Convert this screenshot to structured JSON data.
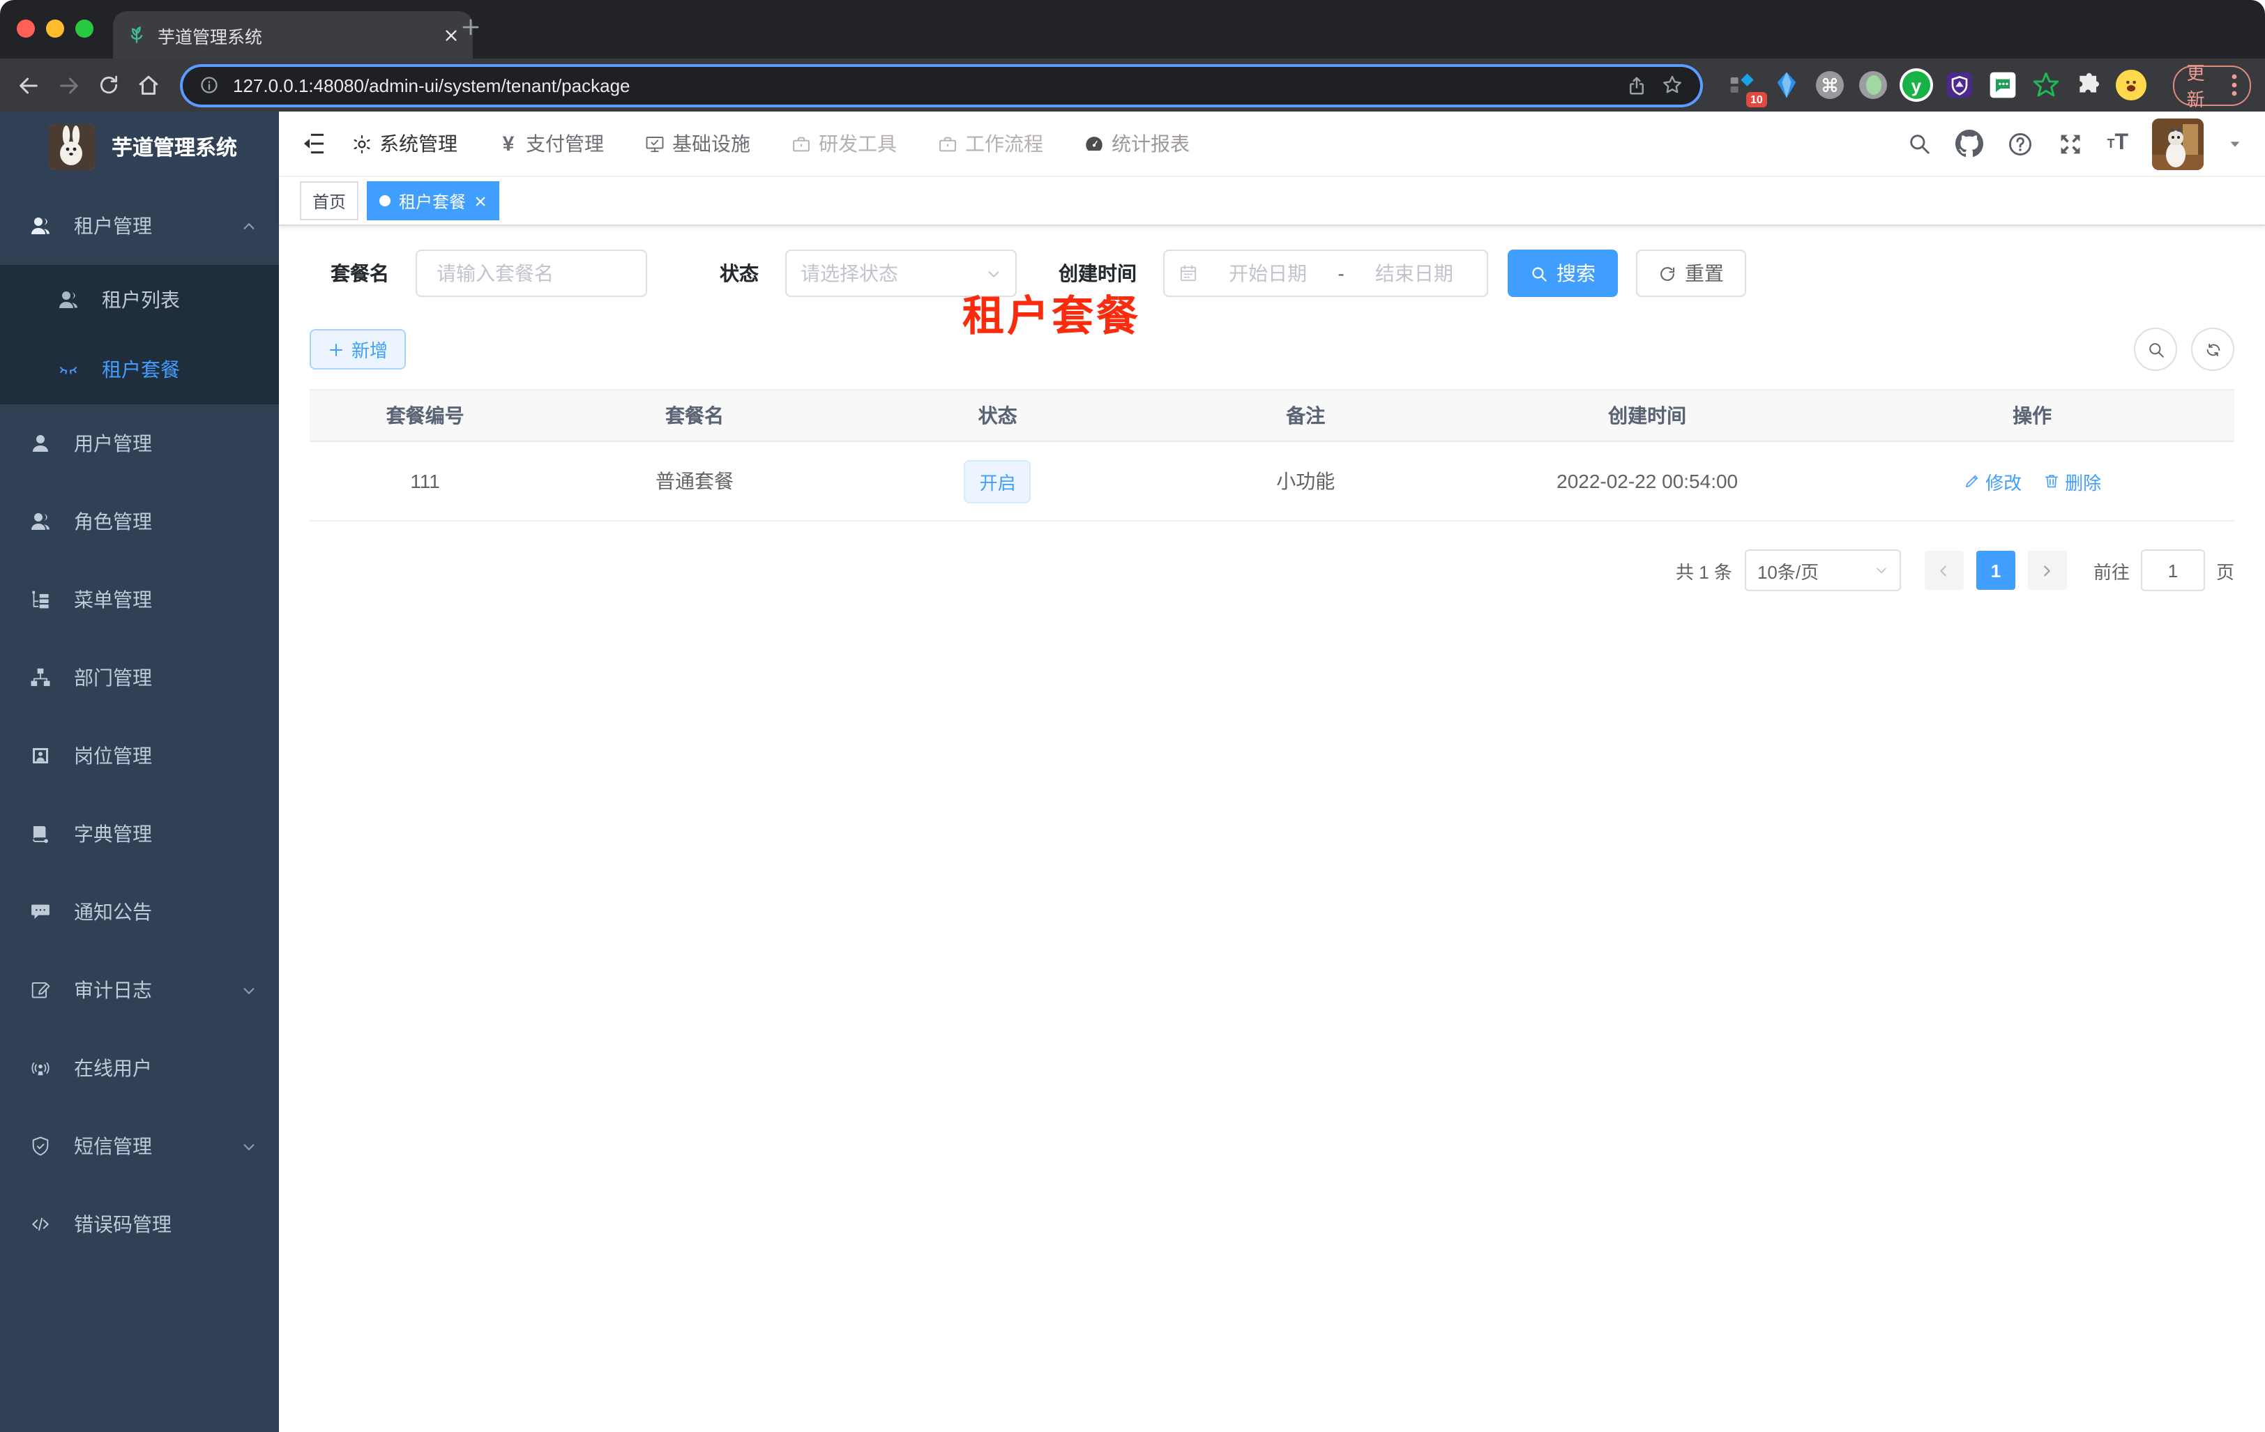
{
  "browser": {
    "tab_title": "芋道管理系统",
    "url": "127.0.0.1:48080/admin-ui/system/tenant/package",
    "update_button": "更新",
    "extension_badge": "10"
  },
  "header": {
    "nav": [
      {
        "label": "系统管理"
      },
      {
        "label": "支付管理"
      },
      {
        "label": "基础设施"
      },
      {
        "label": "研发工具"
      },
      {
        "label": "工作流程"
      },
      {
        "label": "统计报表"
      }
    ]
  },
  "sidebar": {
    "title": "芋道管理系统",
    "items": [
      {
        "label": "租户管理"
      },
      {
        "label": "租户列表"
      },
      {
        "label": "租户套餐"
      },
      {
        "label": "用户管理"
      },
      {
        "label": "角色管理"
      },
      {
        "label": "菜单管理"
      },
      {
        "label": "部门管理"
      },
      {
        "label": "岗位管理"
      },
      {
        "label": "字典管理"
      },
      {
        "label": "通知公告"
      },
      {
        "label": "审计日志"
      },
      {
        "label": "在线用户"
      },
      {
        "label": "短信管理"
      },
      {
        "label": "错误码管理"
      }
    ]
  },
  "tags": {
    "home": "首页",
    "active": "租户套餐"
  },
  "overlay_title": "租户套餐",
  "filters": {
    "name_label": "套餐名",
    "name_placeholder": "请输入套餐名",
    "status_label": "状态",
    "status_placeholder": "请选择状态",
    "date_label": "创建时间",
    "date_start_placeholder": "开始日期",
    "date_separator": "-",
    "date_end_placeholder": "结束日期",
    "search_button": "搜索",
    "reset_button": "重置",
    "add_button": "新增"
  },
  "table": {
    "columns": [
      "套餐编号",
      "套餐名",
      "状态",
      "备注",
      "创建时间",
      "操作"
    ],
    "rows": [
      {
        "id": "111",
        "name": "普通套餐",
        "status": "开启",
        "remark": "小功能",
        "created": "2022-02-22 00:54:00",
        "edit": "修改",
        "delete": "删除"
      }
    ]
  },
  "pagination": {
    "total": "共 1 条",
    "page_size": "10条/页",
    "current": "1",
    "goto_label": "前往",
    "goto_value": "1",
    "unit": "页"
  },
  "colors": {
    "primary": "#409eff",
    "sidebar_bg": "#304156",
    "submenu_bg": "#1f2d3d",
    "overlay_red": "#fb2b0e",
    "status_tag_bg": "#ecf5ff"
  }
}
